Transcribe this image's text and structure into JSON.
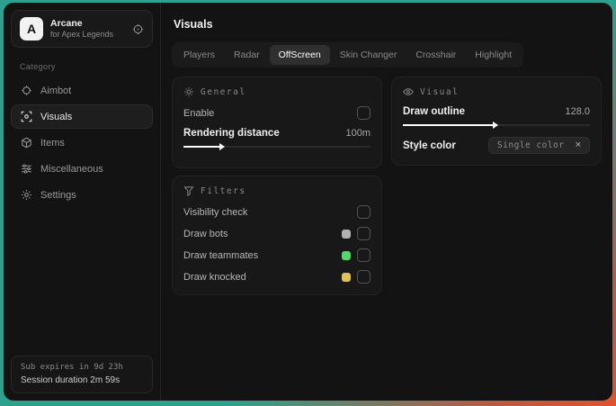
{
  "colors": {
    "accent_teal": "#2da18d",
    "accent_orange": "#e2522e",
    "swatch_bots": "#b2b2b2",
    "swatch_teammates": "#53d769",
    "swatch_knocked": "#e0c254"
  },
  "sidebar": {
    "app": {
      "initial": "A",
      "name": "Arcane",
      "subtitle": "for Apex Legends"
    },
    "category_label": "Category",
    "items": [
      {
        "label": "Aimbot",
        "icon": "crosshair-icon",
        "active": false
      },
      {
        "label": "Visuals",
        "icon": "eye-scan-icon",
        "active": true
      },
      {
        "label": "Items",
        "icon": "cube-icon",
        "active": false
      },
      {
        "label": "Miscellaneous",
        "icon": "sliders-icon",
        "active": false
      },
      {
        "label": "Settings",
        "icon": "gear-icon",
        "active": false
      }
    ],
    "footer": {
      "line1": "Sub expires in 9d 23h",
      "line2": "Session duration 2m 59s"
    }
  },
  "main": {
    "title": "Visuals",
    "tabs": [
      {
        "label": "Players",
        "active": false
      },
      {
        "label": "Radar",
        "active": false
      },
      {
        "label": "OffScreen",
        "active": true
      },
      {
        "label": "Skin Changer",
        "active": false
      },
      {
        "label": "Crosshair",
        "active": false
      },
      {
        "label": "Highlight",
        "active": false
      }
    ],
    "panels": {
      "general": {
        "title": "General",
        "enable_label": "Enable",
        "enable_checked": false,
        "distance_label": "Rendering distance",
        "distance_value": "100m",
        "distance_fill_style": "width:21%"
      },
      "visual": {
        "title": "Visual",
        "outline_label": "Draw outline",
        "outline_value": "128.0",
        "outline_fill_style": "width:50%",
        "style_label": "Style color",
        "style_value": "Single color",
        "style_clear": "×"
      },
      "filters": {
        "title": "Filters",
        "rows": [
          {
            "label": "Visibility check",
            "checked": false
          },
          {
            "label": "Draw bots",
            "swatch_style": "background:#b2b2b2",
            "checked": false
          },
          {
            "label": "Draw teammates",
            "swatch_style": "background:#53d769",
            "checked": false
          },
          {
            "label": "Draw knocked",
            "swatch_style": "background:#e0c254",
            "checked": false
          }
        ]
      }
    }
  }
}
